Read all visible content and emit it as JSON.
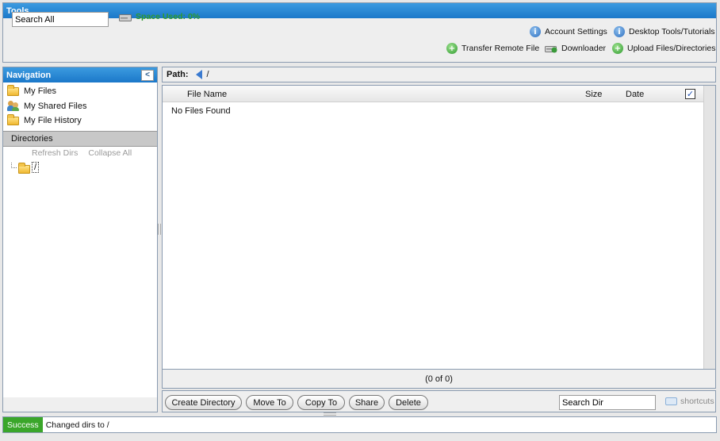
{
  "tools": {
    "title": "Tools",
    "search_value": "Search All",
    "space_used": "Space Used: 0%",
    "links": {
      "account_settings": "Account Settings",
      "desktop_tools": "Desktop Tools/Tutorials",
      "transfer_remote": "Transfer Remote File",
      "downloader": "Downloader",
      "upload": "Upload Files/Directories"
    }
  },
  "navigation": {
    "title": "Navigation",
    "items": [
      {
        "label": "My Files",
        "icon": "folder-icon"
      },
      {
        "label": "My Shared Files",
        "icon": "shared-users-icon"
      },
      {
        "label": "My File History",
        "icon": "folder-icon"
      }
    ],
    "directories_label": "Directories",
    "refresh_dirs": "Refresh Dirs",
    "collapse_all": "Collapse All",
    "tree_root": "/"
  },
  "path": {
    "label": "Path:",
    "value": "/"
  },
  "file_list": {
    "columns": {
      "name": "File Name",
      "size": "Size",
      "date": "Date"
    },
    "empty_message": "No Files Found",
    "pagination": "(0 of 0)"
  },
  "actions": {
    "create_directory": "Create Directory",
    "move_to": "Move To",
    "copy_to": "Copy To",
    "share": "Share",
    "delete": "Delete",
    "search_dir_value": "Search Dir",
    "shortcuts": "shortcuts"
  },
  "status": {
    "badge": "Success",
    "message": "Changed dirs to /"
  },
  "colors": {
    "header_blue": "#1b78c9",
    "success_green": "#3aa62a",
    "space_green": "#2e9a2e"
  }
}
